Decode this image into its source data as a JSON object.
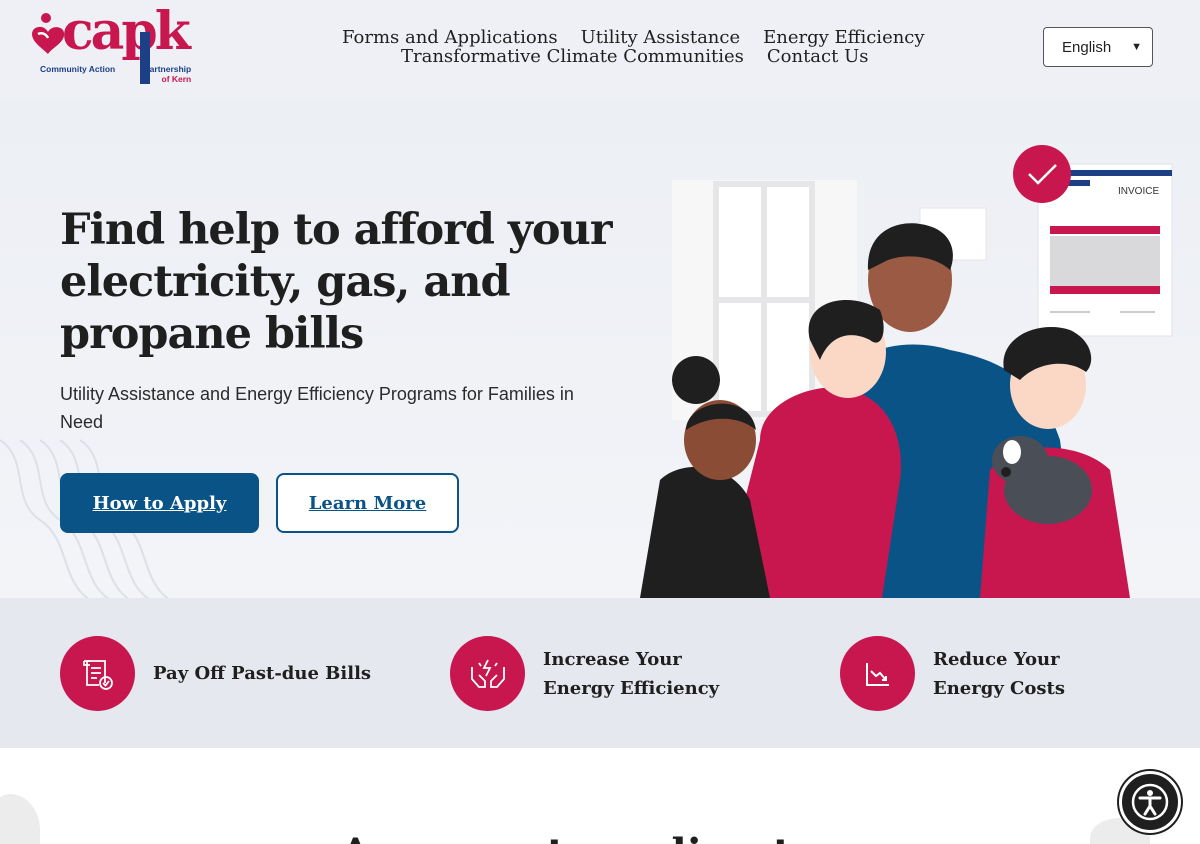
{
  "header": {
    "logo": {
      "word": "capk",
      "sub_left": "Community Action",
      "sub_right_1": "Partnership",
      "sub_right_2": "of Kern"
    },
    "nav": [
      {
        "label": "Forms and Applications"
      },
      {
        "label": "Utility Assistance"
      },
      {
        "label": "Energy Efficiency"
      },
      {
        "label": "Transformative Climate Communities"
      },
      {
        "label": "Contact Us"
      }
    ],
    "language": {
      "selected": "English"
    }
  },
  "hero": {
    "title_bold": "Find help to afford your",
    "title_line2": "electricity, gas, and",
    "title_line3": "propane bills",
    "subtitle": "Utility Assistance and Energy Efficiency Programs for Families in Need",
    "primary_button": "How to Apply",
    "secondary_button": "Learn More",
    "invoice_label": "INVOICE"
  },
  "features": [
    {
      "label": "Pay Off Past-due Bills",
      "icon": "bill-check-icon"
    },
    {
      "label": "Increase Your Energy Efficiency",
      "icon": "hands-energy-icon"
    },
    {
      "label": "Reduce Your Energy Costs",
      "icon": "chart-down-icon"
    }
  ],
  "bottom": {
    "heading": "Are you struggling to"
  },
  "colors": {
    "brand_red": "#c8174f",
    "brand_blue": "#0a5387",
    "navy": "#1c3f86"
  },
  "accessibility_button": {
    "icon": "accessibility-icon"
  }
}
